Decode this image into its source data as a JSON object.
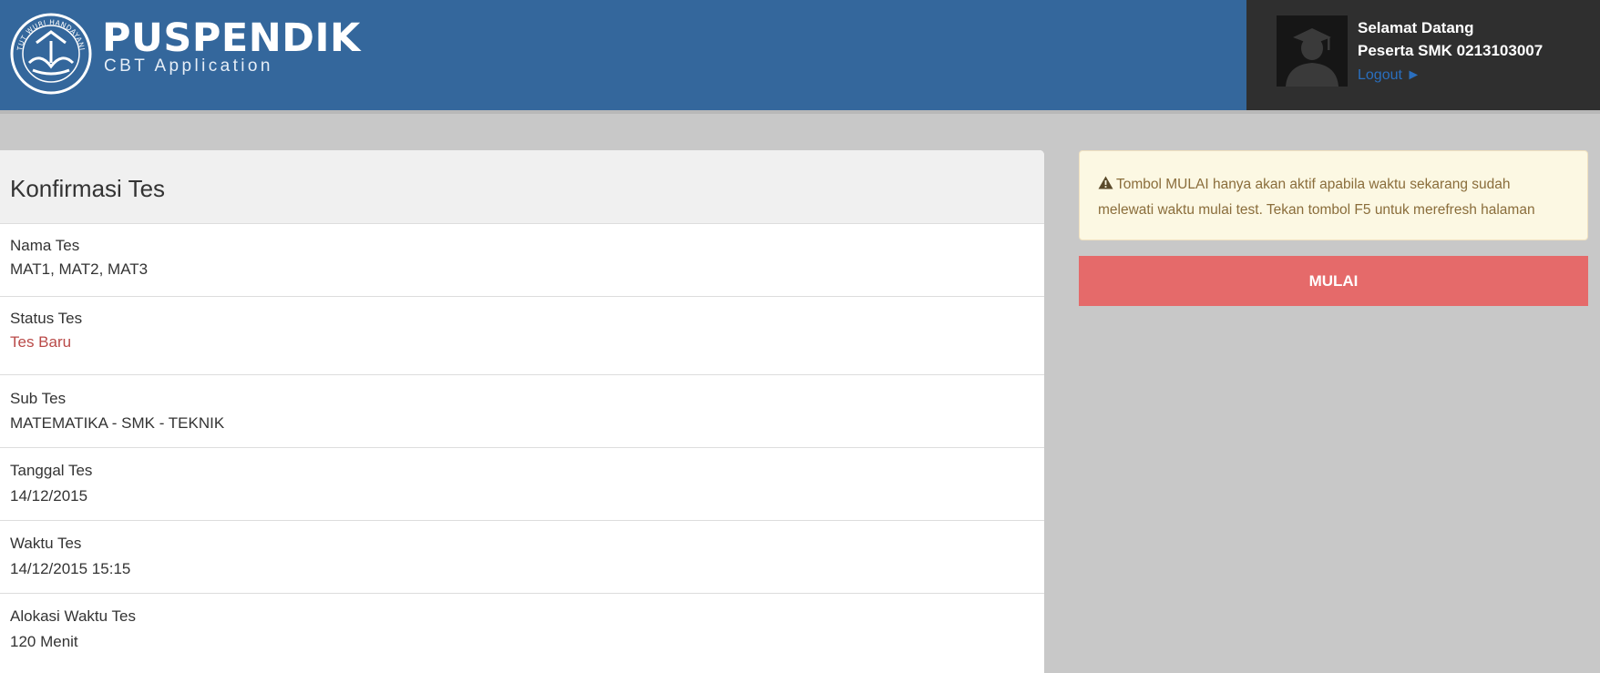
{
  "header": {
    "brand_title": "PUSPENDIK",
    "brand_subtitle": "CBT Application",
    "logo_icon": "tut-wuri-handayani-logo",
    "logo_text": "TUT WURI HANDAYANI"
  },
  "user": {
    "welcome": "Selamat Datang",
    "name": "Peserta SMK 0213103007",
    "logout_label": "Logout ►",
    "avatar_icon": "graduate-avatar-icon"
  },
  "panel": {
    "title": "Konfirmasi Tes",
    "fields": [
      {
        "label": "Nama Tes",
        "value": "MAT1, MAT2, MAT3"
      },
      {
        "label": "Status Tes",
        "value": "Tes Baru"
      },
      {
        "label": "Sub Tes",
        "value": "MATEMATIKA - SMK - TEKNIK"
      },
      {
        "label": "Tanggal Tes",
        "value": "14/12/2015"
      },
      {
        "label": "Waktu Tes",
        "value": "14/12/2015 15:15"
      },
      {
        "label": "Alokasi Waktu Tes",
        "value": "120 Menit"
      }
    ]
  },
  "alert": {
    "icon": "warning-icon",
    "line1": "Tombol MULAI hanya akan aktif apabila waktu sekarang sudah",
    "line2": "melewati waktu mulai test. Tekan tombol F5 untuk merefresh halaman"
  },
  "start_button": {
    "label": "MULAI"
  },
  "colors": {
    "header_bg": "#34679c",
    "user_box_bg": "#2f2f2f",
    "page_bg": "#c8c8c8",
    "status_text": "#b94a48",
    "alert_bg": "#fcf8e3",
    "alert_text": "#8a6d3b",
    "button_bg": "#e56a6a",
    "logout_link": "#2a6fbf"
  }
}
